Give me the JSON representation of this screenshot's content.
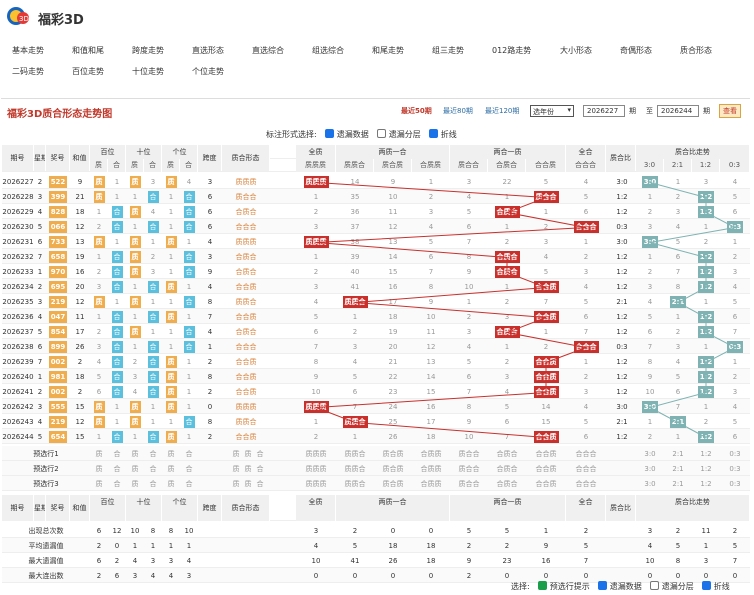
{
  "app": {
    "title": "福彩3D"
  },
  "nav": {
    "row1": [
      "基本走势",
      "和值和尾",
      "跨度走势",
      "直选形态",
      "直选综合",
      "组选综合",
      "和尾走势",
      "组三走势",
      "012路走势",
      "大小形态",
      "奇偶形态",
      "质合形态"
    ],
    "row2": [
      "二码走势",
      "百位走势",
      "十位走势",
      "个位走势"
    ]
  },
  "panel": {
    "title": "福彩3D质合形态走势图",
    "range_links": [
      "最近50期",
      "最近80期",
      "最近120期"
    ],
    "select_value": "选年份",
    "from_value": "2026227",
    "from_label": "期",
    "to_label": "至",
    "to_value": "2026244",
    "to_suffix": "期",
    "query": "查看"
  },
  "label_opts": {
    "prefix": "标注形式选择:",
    "items": [
      "遗漏数据",
      "遗漏分层",
      "折线"
    ],
    "checked": [
      true,
      false,
      true
    ]
  },
  "header": {
    "top": [
      "期号",
      "星期",
      "奖号",
      "和值",
      "百位",
      "十位",
      "个位",
      "跨度",
      "质合形态",
      "全质",
      "两质一合",
      "两合一质",
      "全合",
      "质合比",
      "质合比走势"
    ],
    "sub": [
      "质",
      "合",
      "质",
      "合",
      "质",
      "合",
      "质质质",
      "质质合",
      "质合质",
      "合质质",
      "质合合",
      "合质合",
      "合合质",
      "合合合",
      "3:0",
      "2:1",
      "1:2",
      "0:3"
    ]
  },
  "rows": [
    {
      "issue": "2026227",
      "wd": "2",
      "num": "522",
      "sum": "9",
      "pos": [
        "质",
        "1",
        "质",
        "3",
        "质",
        "4"
      ],
      "span": "3",
      "form": "质质质",
      "cells": [
        "质质质",
        "14",
        "9",
        "1",
        "3",
        "22",
        "5",
        "4"
      ],
      "ratio": "3:0",
      "trend": [
        "3:0",
        "1",
        "3",
        "4"
      ]
    },
    {
      "issue": "2026228",
      "wd": "3",
      "num": "399",
      "sum": "21",
      "pos": [
        "质",
        "1",
        "1",
        "合",
        "1",
        "合"
      ],
      "span": "6",
      "form": "质合合",
      "cells": [
        "1",
        "35",
        "10",
        "2",
        "4",
        "1",
        "质合合",
        "5"
      ],
      "ratio": "1:2",
      "trend": [
        "1",
        "2",
        "1:2",
        "5"
      ]
    },
    {
      "issue": "2026229",
      "wd": "4",
      "num": "828",
      "sum": "18",
      "pos": [
        "1",
        "合",
        "质",
        "4",
        "1",
        "合"
      ],
      "span": "6",
      "form": "合质合",
      "cells": [
        "2",
        "36",
        "11",
        "3",
        "5",
        "合质合",
        "1",
        "6"
      ],
      "ratio": "1:2",
      "trend": [
        "2",
        "3",
        "1:2",
        "6"
      ]
    },
    {
      "issue": "2026230",
      "wd": "5",
      "num": "066",
      "sum": "12",
      "pos": [
        "2",
        "合",
        "1",
        "合",
        "1",
        "合"
      ],
      "span": "6",
      "form": "合合合",
      "cells": [
        "3",
        "37",
        "12",
        "4",
        "6",
        "1",
        "2",
        "合合合"
      ],
      "ratio": "0:3",
      "trend": [
        "3",
        "4",
        "1",
        "0:3"
      ]
    },
    {
      "issue": "2026231",
      "wd": "6",
      "num": "733",
      "sum": "13",
      "pos": [
        "质",
        "1",
        "质",
        "1",
        "质",
        "1"
      ],
      "span": "4",
      "form": "质质质",
      "cells": [
        "质质质",
        "38",
        "13",
        "5",
        "7",
        "2",
        "3",
        "1"
      ],
      "ratio": "3:0",
      "trend": [
        "3:0",
        "5",
        "2",
        "1"
      ]
    },
    {
      "issue": "2026232",
      "wd": "7",
      "num": "658",
      "sum": "19",
      "pos": [
        "1",
        "合",
        "质",
        "2",
        "1",
        "合"
      ],
      "span": "3",
      "form": "合质合",
      "cells": [
        "1",
        "39",
        "14",
        "6",
        "8",
        "合质合",
        "4",
        "2"
      ],
      "ratio": "1:2",
      "trend": [
        "1",
        "6",
        "1:2",
        "2"
      ]
    },
    {
      "issue": "2026233",
      "wd": "1",
      "num": "970",
      "sum": "16",
      "pos": [
        "2",
        "合",
        "质",
        "3",
        "1",
        "合"
      ],
      "span": "9",
      "form": "合质合",
      "cells": [
        "2",
        "40",
        "15",
        "7",
        "9",
        "合质合",
        "5",
        "3"
      ],
      "ratio": "1:2",
      "trend": [
        "2",
        "7",
        "1:2",
        "3"
      ]
    },
    {
      "issue": "2026234",
      "wd": "2",
      "num": "695",
      "sum": "20",
      "pos": [
        "3",
        "合",
        "1",
        "合",
        "质",
        "1"
      ],
      "span": "4",
      "form": "合合质",
      "cells": [
        "3",
        "41",
        "16",
        "8",
        "10",
        "1",
        "合合质",
        "4"
      ],
      "ratio": "1:2",
      "trend": [
        "3",
        "8",
        "1:2",
        "4"
      ]
    },
    {
      "issue": "2026235",
      "wd": "3",
      "num": "219",
      "sum": "12",
      "pos": [
        "质",
        "1",
        "质",
        "1",
        "1",
        "合"
      ],
      "span": "8",
      "form": "质质合",
      "cells": [
        "4",
        "质质合",
        "17",
        "9",
        "1",
        "2",
        "7",
        "5"
      ],
      "ratio": "2:1",
      "trend": [
        "4",
        "2:1",
        "1",
        "5"
      ]
    },
    {
      "issue": "2026236",
      "wd": "4",
      "num": "047",
      "sum": "11",
      "pos": [
        "1",
        "合",
        "1",
        "合",
        "质",
        "1"
      ],
      "span": "7",
      "form": "合合质",
      "cells": [
        "5",
        "1",
        "18",
        "10",
        "2",
        "3",
        "合合质",
        "6"
      ],
      "ratio": "1:2",
      "trend": [
        "5",
        "1",
        "1:2",
        "6"
      ]
    },
    {
      "issue": "2026237",
      "wd": "5",
      "num": "854",
      "sum": "17",
      "pos": [
        "2",
        "合",
        "质",
        "1",
        "1",
        "合"
      ],
      "span": "4",
      "form": "合质合",
      "cells": [
        "6",
        "2",
        "19",
        "11",
        "3",
        "合质合",
        "1",
        "7"
      ],
      "ratio": "1:2",
      "trend": [
        "6",
        "2",
        "1:2",
        "7"
      ]
    },
    {
      "issue": "2026238",
      "wd": "6",
      "num": "899",
      "sum": "26",
      "pos": [
        "3",
        "合",
        "1",
        "合",
        "1",
        "合"
      ],
      "span": "1",
      "form": "合合合",
      "cells": [
        "7",
        "3",
        "20",
        "12",
        "4",
        "1",
        "2",
        "合合合"
      ],
      "ratio": "0:3",
      "trend": [
        "7",
        "3",
        "1",
        "0:3"
      ]
    },
    {
      "issue": "2026239",
      "wd": "7",
      "num": "002",
      "sum": "2",
      "pos": [
        "4",
        "合",
        "2",
        "合",
        "质",
        "1"
      ],
      "span": "2",
      "form": "合合质",
      "cells": [
        "8",
        "4",
        "21",
        "13",
        "5",
        "2",
        "合合质",
        "1"
      ],
      "ratio": "1:2",
      "trend": [
        "8",
        "4",
        "1:2",
        "1"
      ]
    },
    {
      "issue": "2026240",
      "wd": "1",
      "num": "981",
      "sum": "18",
      "pos": [
        "5",
        "合",
        "3",
        "合",
        "质",
        "1"
      ],
      "span": "8",
      "form": "合合质",
      "cells": [
        "9",
        "5",
        "22",
        "14",
        "6",
        "3",
        "合合质",
        "2"
      ],
      "ratio": "1:2",
      "trend": [
        "9",
        "5",
        "1:2",
        "2"
      ]
    },
    {
      "issue": "2026241",
      "wd": "2",
      "num": "002",
      "sum": "2",
      "pos": [
        "6",
        "合",
        "4",
        "合",
        "质",
        "1"
      ],
      "span": "2",
      "form": "合合质",
      "cells": [
        "10",
        "6",
        "23",
        "15",
        "7",
        "4",
        "合合质",
        "3"
      ],
      "ratio": "1:2",
      "trend": [
        "10",
        "6",
        "1:2",
        "3"
      ]
    },
    {
      "issue": "2026242",
      "wd": "3",
      "num": "555",
      "sum": "15",
      "pos": [
        "质",
        "1",
        "质",
        "1",
        "质",
        "1"
      ],
      "span": "0",
      "form": "质质质",
      "cells": [
        "质质质",
        "7",
        "24",
        "16",
        "8",
        "5",
        "14",
        "4"
      ],
      "ratio": "3:0",
      "trend": [
        "3:0",
        "7",
        "1",
        "4"
      ]
    },
    {
      "issue": "2026243",
      "wd": "4",
      "num": "219",
      "sum": "12",
      "pos": [
        "质",
        "1",
        "质",
        "1",
        "1",
        "合"
      ],
      "span": "8",
      "form": "质质合",
      "cells": [
        "1",
        "质质合",
        "25",
        "17",
        "9",
        "6",
        "15",
        "5"
      ],
      "ratio": "2:1",
      "trend": [
        "1",
        "2:1",
        "2",
        "5"
      ]
    },
    {
      "issue": "2026244",
      "wd": "5",
      "num": "654",
      "sum": "15",
      "pos": [
        "1",
        "合",
        "1",
        "合",
        "质",
        "1"
      ],
      "span": "2",
      "form": "合合质",
      "cells": [
        "2",
        "1",
        "26",
        "18",
        "10",
        "7",
        "合合质",
        "6"
      ],
      "ratio": "1:2",
      "trend": [
        "2",
        "1",
        "1:2",
        "6"
      ]
    }
  ],
  "predict": [
    {
      "label": "预选行1",
      "pos": [
        "质",
        "合",
        "质",
        "合",
        "质",
        "合"
      ],
      "form": [
        "质",
        "质",
        "合"
      ],
      "cells": [
        "质质质",
        "质质合",
        "质合质",
        "合质质",
        "质合合",
        "合质合",
        "合合质",
        "合合合"
      ],
      "trend": [
        "3:0",
        "2:1",
        "1:2",
        "0:3"
      ]
    },
    {
      "label": "预选行2",
      "pos": [
        "质",
        "合",
        "质",
        "合",
        "质",
        "合"
      ],
      "form": [
        "质",
        "质",
        "合"
      ],
      "cells": [
        "质质质",
        "质质合",
        "质合质",
        "合质质",
        "质合合",
        "合质合",
        "合合质",
        "合合合"
      ],
      "trend": [
        "3:0",
        "2:1",
        "1:2",
        "0:3"
      ]
    },
    {
      "label": "预选行3",
      "pos": [
        "质",
        "合",
        "质",
        "合",
        "质",
        "合"
      ],
      "form": [
        "质",
        "质",
        "合"
      ],
      "cells": [
        "质质质",
        "质质合",
        "质合质",
        "合质质",
        "质合合",
        "合质合",
        "合合质",
        "合合合"
      ],
      "trend": [
        "3:0",
        "2:1",
        "1:2",
        "0:3"
      ]
    }
  ],
  "stats": [
    {
      "label": "出现总次数",
      "pos": [
        "6",
        "12",
        "10",
        "8",
        "8",
        "10"
      ],
      "cells": [
        "3",
        "2",
        "0",
        "0",
        "5",
        "5",
        "1",
        "2"
      ],
      "trend": [
        "3",
        "2",
        "11",
        "2"
      ]
    },
    {
      "label": "平均遗漏值",
      "pos": [
        "2",
        "0",
        "1",
        "1",
        "1",
        "1"
      ],
      "cells": [
        "4",
        "5",
        "18",
        "18",
        "2",
        "2",
        "9",
        "5"
      ],
      "trend": [
        "4",
        "5",
        "1",
        "5"
      ]
    },
    {
      "label": "最大遗漏值",
      "pos": [
        "6",
        "2",
        "4",
        "3",
        "3",
        "4"
      ],
      "cells": [
        "10",
        "41",
        "26",
        "18",
        "9",
        "23",
        "16",
        "7"
      ],
      "trend": [
        "10",
        "8",
        "3",
        "7"
      ]
    },
    {
      "label": "最大连出数",
      "pos": [
        "2",
        "6",
        "3",
        "4",
        "4",
        "3"
      ],
      "cells": [
        "0",
        "0",
        "0",
        "0",
        "2",
        "0",
        "0",
        "0"
      ],
      "trend": [
        "0",
        "0",
        "0",
        "0"
      ]
    }
  ],
  "bottom": {
    "prefix": "选择:",
    "items": [
      "预选行提示",
      "遗漏数据",
      "遗漏分层",
      "折线"
    ]
  },
  "colors": {
    "title_red": "#c0392b",
    "odd_box": "#f0ad4e",
    "form_box": "#c9302c",
    "ratio_box": "#7fb3b3",
    "link_blue": "#2e6da4"
  }
}
